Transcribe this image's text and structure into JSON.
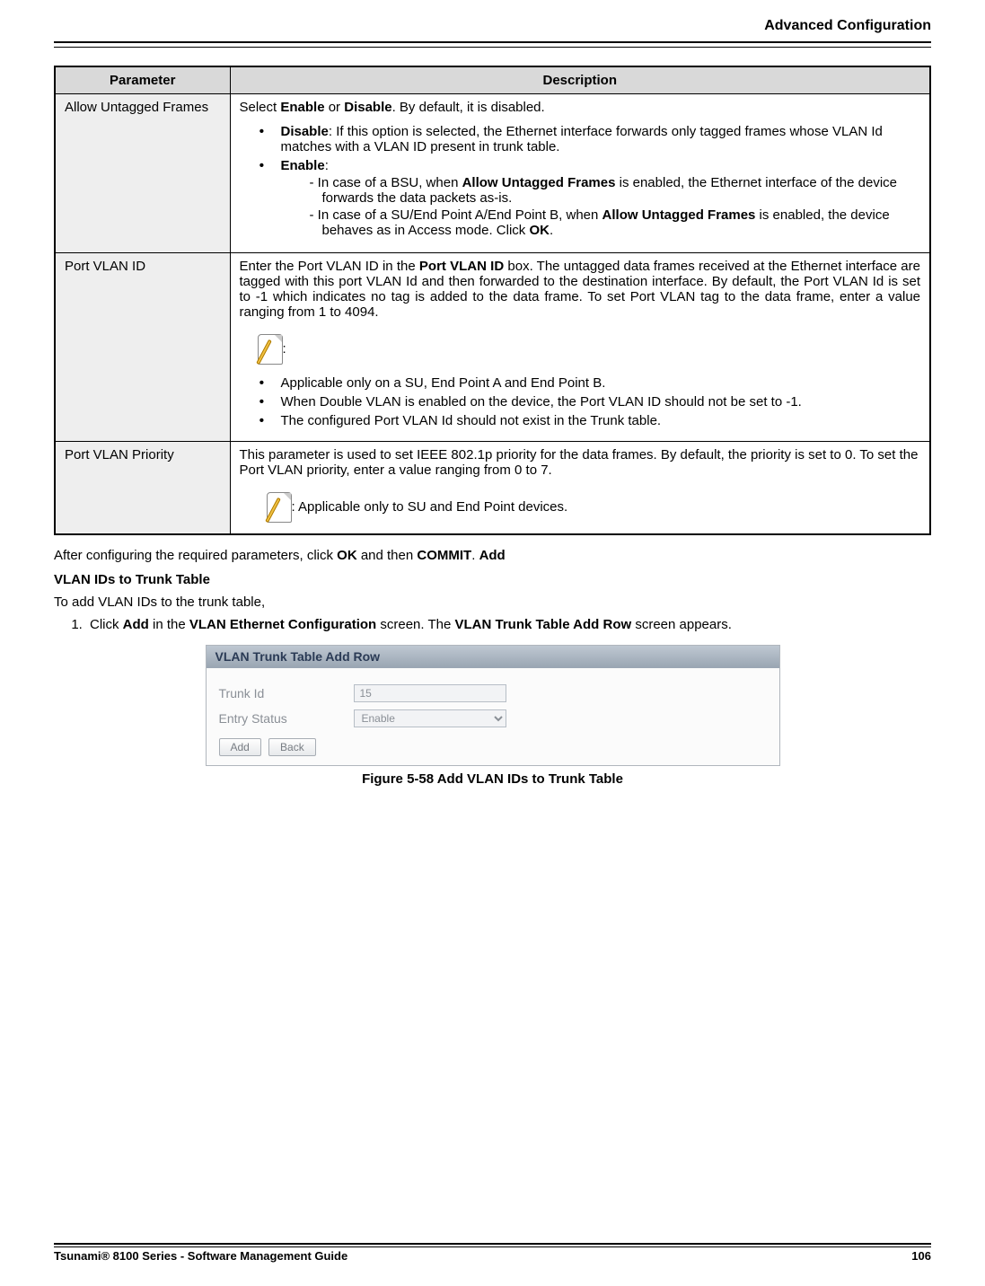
{
  "header": {
    "title": "Advanced Configuration"
  },
  "table": {
    "columns": {
      "param": "Parameter",
      "desc": "Description"
    },
    "rows": {
      "allow": {
        "param": "Allow Untagged Frames",
        "intro_pre": "Select ",
        "enable_word": "Enable",
        "or_word": " or ",
        "disable_word": "Disable",
        "intro_post": ". By default, it is disabled.",
        "b1_label": "Disable",
        "b1_text": ": If this option is selected, the Ethernet interface forwards only tagged frames whose VLAN Id matches with a VLAN ID present in trunk table.",
        "b2_label": "Enable",
        "b2_text": ":",
        "s1a": "- In case of a BSU, when ",
        "s1b": "Allow Untagged Frames",
        "s1c": " is enabled, the Ethernet interface of the device forwards the data packets as-is.",
        "s2a": "- In case of a SU/End Point A/End Point B, when ",
        "s2b": "Allow Untagged Frames",
        "s2c": " is enabled, the device behaves as in Access mode. Click ",
        "s2d": "OK",
        "s2e": "."
      },
      "pvid": {
        "param": "Port VLAN ID",
        "p1a": "Enter the Port VLAN ID in the ",
        "p1b": "Port VLAN ID",
        "p1c": " box. The untagged data frames received at the Ethernet interface are tagged with this port VLAN Id and then forwarded to the destination interface. By default, the Port VLAN Id is set to -1 which indicates no tag is added to the data frame. To set Port VLAN tag to the data frame, enter a value ranging from 1 to 4094.",
        "note_colon": ":",
        "n1": "Applicable only on a SU, End Point A and End Point B.",
        "n2": "When Double VLAN is enabled on the device, the Port VLAN ID should not be set to -1.",
        "n3": "The configured Port VLAN Id should not exist in the Trunk table."
      },
      "prio": {
        "param": "Port VLAN Priority",
        "p1": "This parameter is used to set IEEE 802.1p priority for the data frames. By default, the priority is set to 0. To set the Port VLAN priority, enter a value ranging from 0 to 7.",
        "note_text": ": Applicable only to SU and End Point devices."
      }
    }
  },
  "after": {
    "t1a": "After configuring the required parameters, click ",
    "t1b": "OK",
    "t1c": " and then ",
    "t1d": "COMMIT",
    "t1e": ". ",
    "t1f": "Add",
    "heading": "VLAN IDs to Trunk Table",
    "t2": "To add VLAN IDs to the trunk table,",
    "step1a": "Click ",
    "step1b": "Add",
    "step1c": " in the ",
    "step1d": "VLAN Ethernet Configuration",
    "step1e": " screen. The ",
    "step1f": "VLAN Trunk Table Add Row",
    "step1g": " screen appears."
  },
  "panel": {
    "title": "VLAN Trunk Table Add Row",
    "row1_label": "Trunk Id",
    "row1_value": "15",
    "row2_label": "Entry Status",
    "row2_value": "Enable",
    "btn_add": "Add",
    "btn_back": "Back"
  },
  "figure_caption": "Figure 5-58 Add VLAN IDs to Trunk Table",
  "footer": {
    "left": "Tsunami® 8100 Series - Software Management Guide",
    "right": "106"
  }
}
